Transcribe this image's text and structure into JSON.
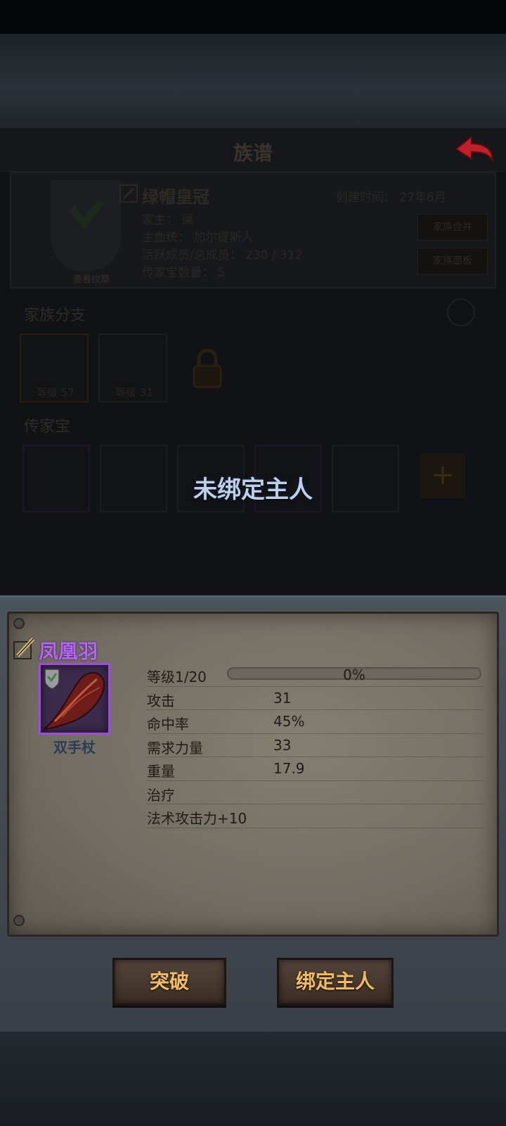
{
  "family": {
    "title": "族谱",
    "name": "绿帽皇冠",
    "founded": "创建时间： 27年6月",
    "leader": "家主： 屎",
    "bloodline": "主血统： 加尔提斯人",
    "members": "活跃成员/总成员： 230 / 312",
    "heirloom_count": "传家宝数量： 5",
    "crest_label": "查看纹章",
    "merge_label": "家族合并",
    "dissolve_label": "家族面板",
    "branch_title": "家族分支",
    "heirloom_title": "传家宝",
    "branches": [
      {
        "level": "等级 57"
      },
      {
        "level": "等级 31"
      }
    ],
    "heirloom_slots": 5,
    "add_label": "+"
  },
  "overlay_text": "未绑定主人",
  "item": {
    "name": "凤凰羽",
    "type": "双手杖",
    "level_label": "等级1/20",
    "xp_percent": 0,
    "xp_text": "0%",
    "stats": [
      {
        "label": "攻击",
        "value": "31"
      },
      {
        "label": "命中率",
        "value": "45%"
      },
      {
        "label": "需求力量",
        "value": "33"
      },
      {
        "label": "重量",
        "value": "17.9"
      },
      {
        "label": "治疗",
        "value": ""
      },
      {
        "label": "法术攻击力+10",
        "value": ""
      }
    ]
  },
  "actions": {
    "breakthrough": "突破",
    "bind_owner": "绑定主人"
  },
  "colors": {
    "item_rarity": "#b366f0",
    "button_text": "#f2bc62",
    "overlay_text": "#bcd0ea"
  }
}
